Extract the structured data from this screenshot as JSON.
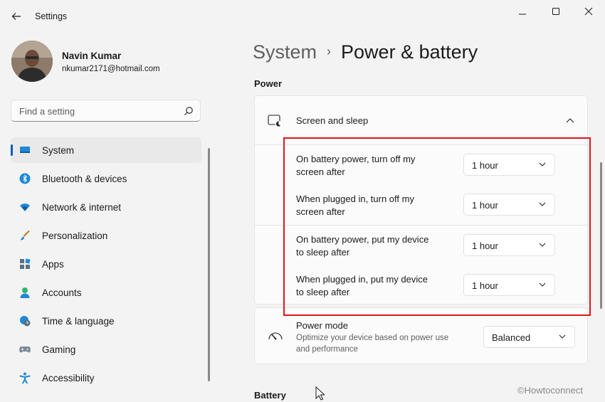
{
  "window": {
    "app_title": "Settings"
  },
  "profile": {
    "name": "Navin Kumar",
    "email": "nkumar2171@hotmail.com"
  },
  "search": {
    "placeholder": "Find a setting"
  },
  "nav": {
    "items": [
      {
        "label": "System",
        "icon": "system-icon",
        "active": true
      },
      {
        "label": "Bluetooth & devices",
        "icon": "bluetooth-icon"
      },
      {
        "label": "Network & internet",
        "icon": "wifi-icon"
      },
      {
        "label": "Personalization",
        "icon": "brush-icon"
      },
      {
        "label": "Apps",
        "icon": "apps-icon"
      },
      {
        "label": "Accounts",
        "icon": "person-icon"
      },
      {
        "label": "Time & language",
        "icon": "globe-clock-icon"
      },
      {
        "label": "Gaming",
        "icon": "gamepad-icon"
      },
      {
        "label": "Accessibility",
        "icon": "accessibility-icon"
      }
    ]
  },
  "breadcrumb": {
    "parent": "System",
    "separator": "›",
    "current": "Power & battery"
  },
  "power": {
    "section_title": "Power",
    "screen_sleep": {
      "title": "Screen and sleep",
      "settings": [
        {
          "line1": "On battery power, turn off my",
          "line2": "screen after",
          "value": "1 hour"
        },
        {
          "line1": "When plugged in, turn off my",
          "line2": "screen after",
          "value": "1 hour"
        },
        {
          "line1": "On battery power, put my device",
          "line2": "to sleep after",
          "value": "1 hour"
        },
        {
          "line1": "When plugged in, put my device",
          "line2": "to sleep after",
          "value": "1 hour"
        }
      ]
    },
    "power_mode": {
      "title": "Power mode",
      "desc_line1": "Optimize your device based on power use",
      "desc_line2": "and performance",
      "value": "Balanced"
    }
  },
  "battery": {
    "section_title": "Battery"
  },
  "watermark": "©Howtoconnect",
  "colors": {
    "accent": "#005fb8",
    "highlight": "#e0141b"
  }
}
